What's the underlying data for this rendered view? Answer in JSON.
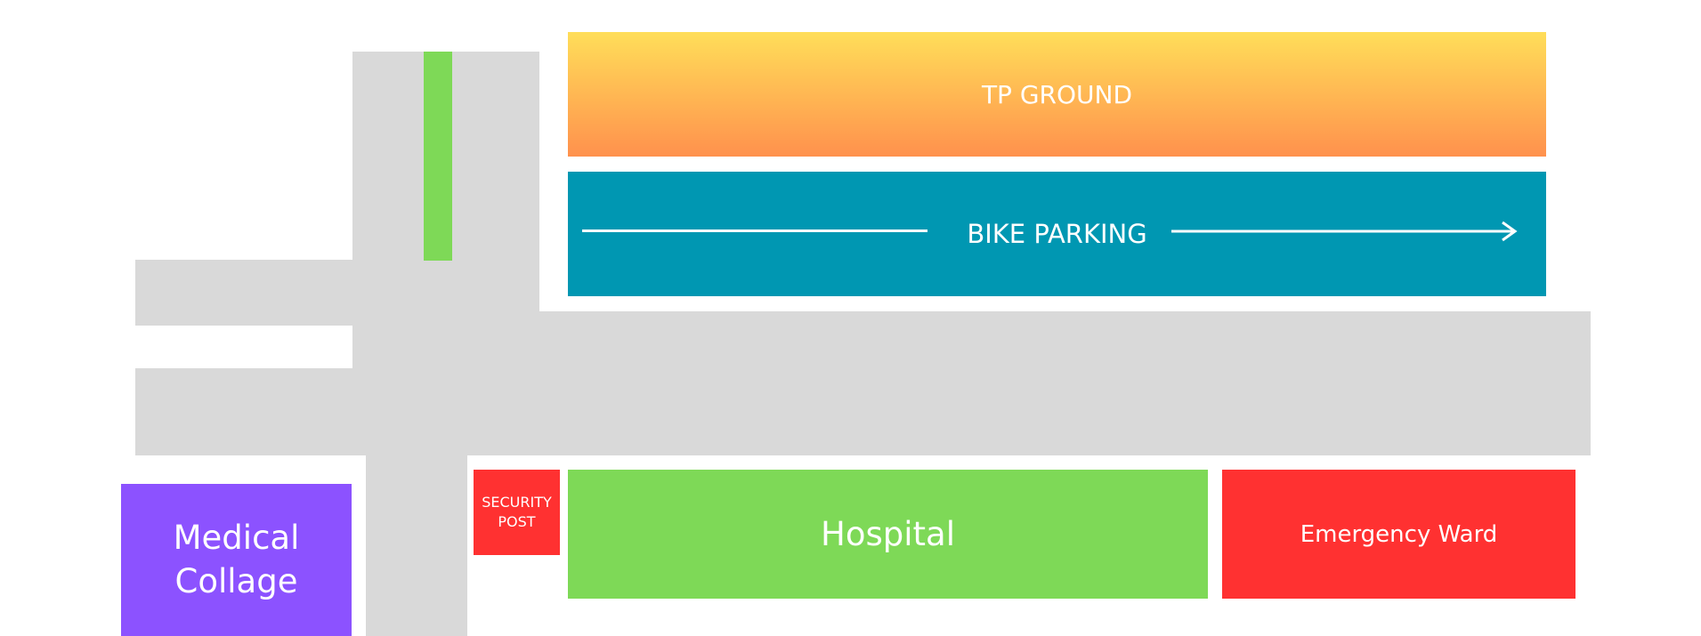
{
  "colors": {
    "road": "#d9d9d9",
    "divider": "#7ed957",
    "tp_ground_top": "#ffde59",
    "tp_ground_bottom": "#ff914d",
    "bike_parking": "#0097b2",
    "medical_college": "#8c52ff",
    "security_post": "#ff3131",
    "hospital": "#7ed957",
    "emergency_ward": "#ff3131",
    "label_text": "#ffffff"
  },
  "areas": {
    "tp_ground": "TP GROUND",
    "bike_parking": "BIKE PARKING",
    "medical_college": "Medical Collage",
    "security_post": "SECURITY POST",
    "hospital": "Hospital",
    "emergency_ward": "Emergency Ward"
  }
}
